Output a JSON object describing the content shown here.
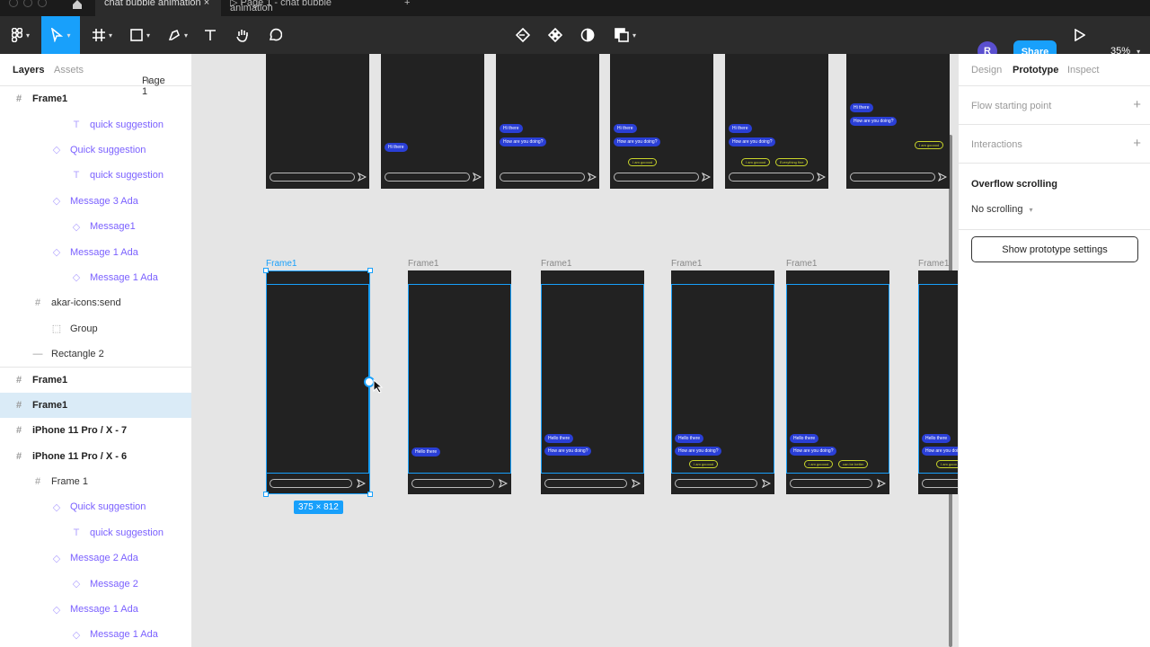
{
  "tabs": [
    {
      "label": "chat bubble animation"
    },
    {
      "label": "Page 1 - chat bubble animation"
    }
  ],
  "toolbar": {
    "avatar_initial": "R",
    "share_label": "Share",
    "zoom": "35%"
  },
  "left_panel": {
    "tab_layers": "Layers",
    "tab_assets": "Assets",
    "page_selector": "Page 1",
    "layers": [
      {
        "label": "Frame1",
        "icon": "frame-icon"
      },
      {
        "label": "quick suggestion",
        "icon": "text-icon"
      },
      {
        "label": "Quick suggestion",
        "icon": "component-icon"
      },
      {
        "label": "quick suggestion",
        "icon": "text-icon"
      },
      {
        "label": "Message 3 Ada",
        "icon": "component-icon"
      },
      {
        "label": "Message1",
        "icon": "component-icon"
      },
      {
        "label": "Message 1 Ada",
        "icon": "component-icon"
      },
      {
        "label": "Message 1 Ada",
        "icon": "component-icon"
      },
      {
        "label": "akar-icons:send",
        "icon": "frame-icon"
      },
      {
        "label": "Group",
        "icon": "group-icon"
      },
      {
        "label": "Rectangle 2",
        "icon": "line-icon"
      },
      {
        "label": "Frame1",
        "icon": "frame-icon"
      },
      {
        "label": "Frame1",
        "icon": "frame-icon"
      },
      {
        "label": "iPhone 11 Pro / X - 7",
        "icon": "frame-icon"
      },
      {
        "label": "iPhone 11 Pro / X - 6",
        "icon": "frame-icon"
      },
      {
        "label": "Frame 1",
        "icon": "frame-icon"
      },
      {
        "label": "Quick suggestion",
        "icon": "component-icon"
      },
      {
        "label": "quick suggestion",
        "icon": "text-icon"
      },
      {
        "label": "Message 2 Ada",
        "icon": "component-icon"
      },
      {
        "label": "Message 2",
        "icon": "component-icon"
      },
      {
        "label": "Message 1 Ada",
        "icon": "component-icon"
      },
      {
        "label": "Message 1 Ada",
        "icon": "component-icon"
      }
    ]
  },
  "canvas": {
    "frame_label": "Frame1",
    "selection_size": "375 × 812",
    "top_frames": [
      {
        "bubbles": [],
        "suggestions": []
      },
      {
        "bubbles": [
          "Hi there"
        ],
        "suggestions": []
      },
      {
        "bubbles": [
          "Hi there",
          "How are you doing?"
        ],
        "suggestions": []
      },
      {
        "bubbles": [
          "Hi there",
          "How are you doing?"
        ],
        "suggestions": [
          "I am gooood"
        ]
      },
      {
        "bubbles": [
          "Hi there",
          "How are you doing?"
        ],
        "suggestions": [
          "I am gooood",
          "Everything fine"
        ]
      },
      {
        "bubbles": [
          "Hi there",
          "How are you doing?"
        ],
        "suggestions": [
          "I am gooood"
        ]
      }
    ],
    "bottom_frames": [
      {
        "bubbles": [],
        "suggestions": []
      },
      {
        "bubbles": [
          "Hello there"
        ],
        "suggestions": []
      },
      {
        "bubbles": [
          "Hello there",
          "How are you doing?"
        ],
        "suggestions": []
      },
      {
        "bubbles": [
          "Hello there",
          "How are you doing?"
        ],
        "suggestions": [
          "I am gooood"
        ]
      },
      {
        "bubbles": [
          "Hello there",
          "How are you doing?"
        ],
        "suggestions": [
          "I am gooood",
          "can be better"
        ]
      },
      {
        "bubbles": [
          "Hello there",
          "How are you doing?"
        ],
        "suggestions": [
          "I am gooo"
        ]
      }
    ]
  },
  "right_panel": {
    "tab_design": "Design",
    "tab_prototype": "Prototype",
    "tab_inspect": "Inspect",
    "flow_starting_point": "Flow starting point",
    "interactions": "Interactions",
    "overflow_title": "Overflow scrolling",
    "overflow_value": "No scrolling",
    "prototype_settings_button": "Show prototype settings"
  },
  "colors": {
    "accent": "#18a0fb",
    "bubble": "#2a3fd6",
    "suggestion": "#c8d42a",
    "frame": "#222222"
  }
}
